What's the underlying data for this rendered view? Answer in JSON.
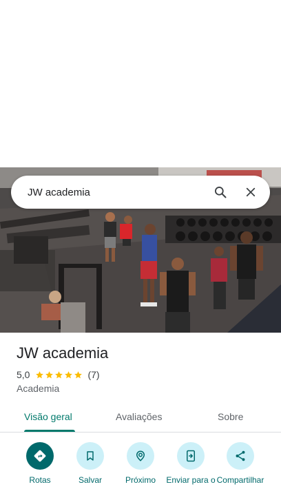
{
  "search": {
    "query": "JW academia"
  },
  "place": {
    "name": "JW academia",
    "rating": "5,0",
    "stars": 5,
    "review_count": "(7)",
    "category": "Academia"
  },
  "tabs": [
    {
      "label": "Visão geral",
      "active": true
    },
    {
      "label": "Avaliações",
      "active": false
    },
    {
      "label": "Sobre",
      "active": false
    }
  ],
  "actions": [
    {
      "label": "Rotas",
      "icon": "directions-icon"
    },
    {
      "label": "Salvar",
      "icon": "bookmark-icon"
    },
    {
      "label": "Próximo",
      "icon": "nearby-icon"
    },
    {
      "label": "Enviar para o",
      "icon": "send-to-phone-icon"
    },
    {
      "label": "Compartilhar",
      "icon": "share-icon"
    }
  ],
  "colors": {
    "accent": "#00796b",
    "action_bg": "#ccf0f8",
    "star": "#fbbc04"
  }
}
